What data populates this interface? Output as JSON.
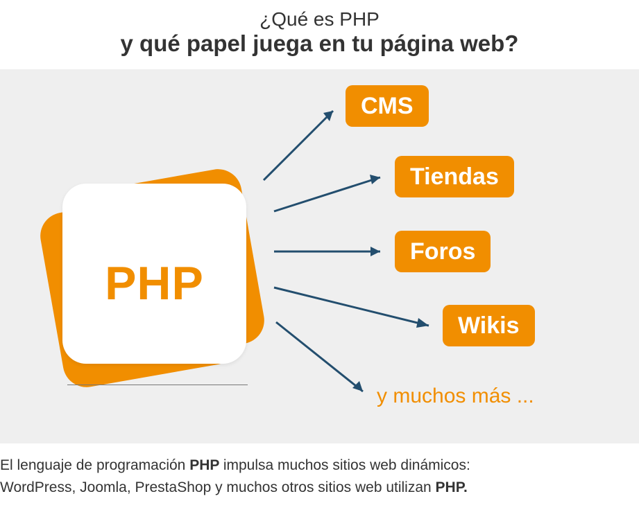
{
  "heading": {
    "line1": "¿Qué es PHP",
    "line2": "y qué papel juega en tu página web?"
  },
  "source": {
    "label": "PHP"
  },
  "targets": [
    {
      "label": "CMS"
    },
    {
      "label": "Tiendas"
    },
    {
      "label": "Foros"
    },
    {
      "label": "Wikis"
    }
  ],
  "more_text": "y muchos más ...",
  "footer": {
    "line1_a": "El lenguaje de programación ",
    "line1_b": "PHP ",
    "line1_c": "impulsa muchos sitios web dinámicos:",
    "line2_a": "WordPress, Joomla, PrestaShop y muchos otros sitios web utilizan ",
    "line2_b": "PHP."
  }
}
